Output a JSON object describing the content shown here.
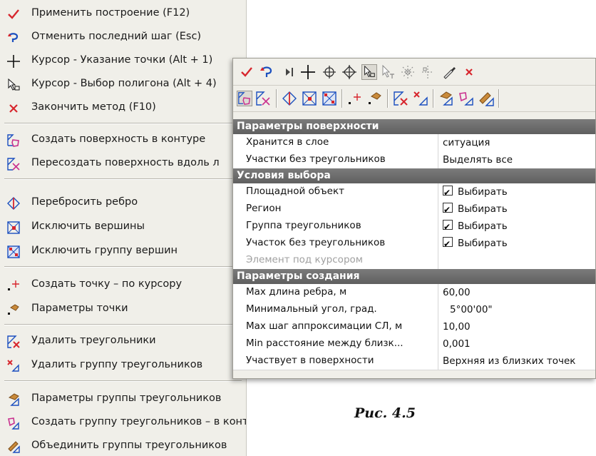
{
  "menu": {
    "items": [
      {
        "label": "Применить построение (F12)",
        "icon": "check-icon"
      },
      {
        "label": "Отменить последний шаг (Esc)",
        "icon": "undo-icon"
      },
      {
        "label": "Курсор - Указание точки (Alt + 1)",
        "icon": "crosshair-icon"
      },
      {
        "label": "Курсор - Выбор полигона (Alt + 4)",
        "icon": "polygon-cursor-icon"
      },
      {
        "label": "Закончить метод (F10)",
        "icon": "cross-icon"
      },
      {
        "label": "Создать поверхность в контуре",
        "icon": "surface-contour-icon"
      },
      {
        "label": "Пересоздать поверхность вдоль л",
        "icon": "surface-recreate-icon"
      },
      {
        "label": "Перебросить ребро",
        "icon": "flip-edge-icon"
      },
      {
        "label": "Исключить вершины",
        "icon": "exclude-vertices-icon"
      },
      {
        "label": "Исключить группу вершин",
        "icon": "exclude-vertex-group-icon"
      },
      {
        "label": "Создать точку – по курсору",
        "icon": "create-point-icon"
      },
      {
        "label": "Параметры точки",
        "icon": "point-params-icon"
      },
      {
        "label": "Удалить треугольники",
        "icon": "delete-triangles-icon"
      },
      {
        "label": "Удалить группу треугольников",
        "icon": "delete-triangle-group-icon"
      },
      {
        "label": "Параметры группы треугольников",
        "icon": "triangle-group-params-icon"
      },
      {
        "label": "Создать группу треугольников – в контуре",
        "icon": "create-triangle-group-icon"
      },
      {
        "label": "Объединить группы треугольников",
        "icon": "merge-triangle-groups-icon"
      }
    ]
  },
  "panel": {
    "sections": [
      {
        "title": "Параметры поверхности",
        "rows": [
          {
            "name": "Хранится в слое",
            "value": "ситуация"
          },
          {
            "name": "Участки без треугольников",
            "value": "Выделять все"
          }
        ]
      },
      {
        "title": "Условия выбора",
        "rows": [
          {
            "name": "Площадной объект",
            "value": "Выбирать",
            "checked": true
          },
          {
            "name": "Регион",
            "value": "Выбирать",
            "checked": true
          },
          {
            "name": "Группа треугольников",
            "value": "Выбирать",
            "checked": true
          },
          {
            "name": "Участок без треугольников",
            "value": "Выбирать",
            "checked": true
          },
          {
            "name": "Элемент под курсором",
            "value": "",
            "disabled": true
          }
        ]
      },
      {
        "title": "Параметры создания",
        "rows": [
          {
            "name": "Max длина ребра, м",
            "value": "60,00"
          },
          {
            "name": "Минимальный угол, град.",
            "value": "5°00'00\""
          },
          {
            "name": "Max шаг аппроксимации СЛ, м",
            "value": "10,00"
          },
          {
            "name": "Min расстояние между близк...",
            "value": "0,001"
          },
          {
            "name": "Участвует в поверхности",
            "value": "Верхняя из близких точек"
          }
        ]
      }
    ]
  },
  "caption": "Рис. 4.5",
  "colors": {
    "accent_red": "#d7262d",
    "blue": "#1a4fbf",
    "pink": "#c9308e",
    "header_gray": "#6d6d6d",
    "menu_bg": "#f0efe9"
  }
}
